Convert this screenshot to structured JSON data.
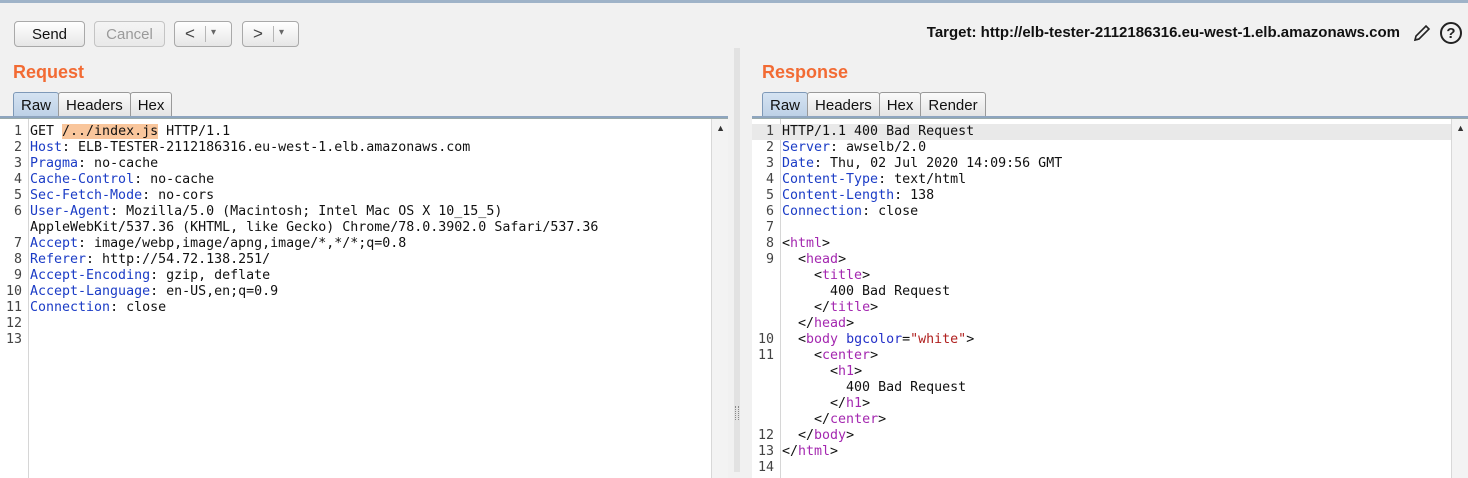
{
  "toolbar": {
    "send_label": "Send",
    "cancel_label": "Cancel",
    "back_label": "<",
    "forward_label": ">",
    "caret": "▾",
    "target_label": "Target: http://elb-tester-2112186316.eu-west-1.elb.amazonaws.com",
    "help_label": "?"
  },
  "request": {
    "title": "Request",
    "tabs": [
      "Raw",
      "Headers",
      "Hex"
    ],
    "active_tab": "Raw",
    "line_numbers": [
      "1",
      "2",
      "3",
      "4",
      "5",
      "6",
      "",
      "7",
      "8",
      "9",
      "10",
      "11",
      "12",
      "13"
    ],
    "lines": [
      [
        {
          "t": "GET "
        },
        {
          "t": "/../index.js",
          "c": "hl"
        },
        {
          "t": " HTTP/1.1"
        }
      ],
      [
        {
          "t": "Host",
          "c": "hdr"
        },
        {
          "t": ": ELB-TESTER-2112186316.eu-west-1.elb.amazonaws.com"
        }
      ],
      [
        {
          "t": "Pragma",
          "c": "hdr"
        },
        {
          "t": ": no-cache"
        }
      ],
      [
        {
          "t": "Cache-Control",
          "c": "hdr"
        },
        {
          "t": ": no-cache"
        }
      ],
      [
        {
          "t": "Sec-Fetch-Mode",
          "c": "hdr"
        },
        {
          "t": ": no-cors"
        }
      ],
      [
        {
          "t": "User-Agent",
          "c": "hdr"
        },
        {
          "t": ": Mozilla/5.0 (Macintosh; Intel Mac OS X 10_15_5)"
        }
      ],
      [
        {
          "t": "AppleWebKit/537.36 (KHTML, like Gecko) Chrome/78.0.3902.0 Safari/537.36"
        }
      ],
      [
        {
          "t": "Accept",
          "c": "hdr"
        },
        {
          "t": ": image/webp,image/apng,image/*,*/*;q=0.8"
        }
      ],
      [
        {
          "t": "Referer",
          "c": "hdr"
        },
        {
          "t": ": http://54.72.138.251/"
        }
      ],
      [
        {
          "t": "Accept-Encoding",
          "c": "hdr"
        },
        {
          "t": ": gzip, deflate"
        }
      ],
      [
        {
          "t": "Accept-Language",
          "c": "hdr"
        },
        {
          "t": ": en-US,en;q=0.9"
        }
      ],
      [
        {
          "t": "Connection",
          "c": "hdr"
        },
        {
          "t": ": close"
        }
      ],
      [],
      []
    ]
  },
  "response": {
    "title": "Response",
    "tabs": [
      "Raw",
      "Headers",
      "Hex",
      "Render"
    ],
    "active_tab": "Raw",
    "line_numbers": [
      "1",
      "2",
      "3",
      "4",
      "5",
      "6",
      "7",
      "8",
      "9",
      "",
      "",
      "",
      "",
      "10",
      "11",
      "",
      "",
      "",
      "",
      "12",
      "13",
      "14"
    ],
    "lines": [
      [
        {
          "t": "HTTP/1.1 400 Bad Request"
        }
      ],
      [
        {
          "t": "Server",
          "c": "hdr"
        },
        {
          "t": ": awselb/2.0"
        }
      ],
      [
        {
          "t": "Date",
          "c": "hdr"
        },
        {
          "t": ": Thu, 02 Jul 2020 14:09:56 GMT"
        }
      ],
      [
        {
          "t": "Content-Type",
          "c": "hdr"
        },
        {
          "t": ": text/html"
        }
      ],
      [
        {
          "t": "Content-Length",
          "c": "hdr"
        },
        {
          "t": ": 138"
        }
      ],
      [
        {
          "t": "Connection",
          "c": "hdr"
        },
        {
          "t": ": close"
        }
      ],
      [],
      [
        {
          "t": "<"
        },
        {
          "t": "html",
          "c": "tag"
        },
        {
          "t": ">"
        }
      ],
      [
        {
          "t": "  <"
        },
        {
          "t": "head",
          "c": "tag"
        },
        {
          "t": ">"
        }
      ],
      [
        {
          "t": "    <"
        },
        {
          "t": "title",
          "c": "tag"
        },
        {
          "t": ">"
        }
      ],
      [
        {
          "t": "      400 Bad Request"
        }
      ],
      [
        {
          "t": "    </"
        },
        {
          "t": "title",
          "c": "tag"
        },
        {
          "t": ">"
        }
      ],
      [
        {
          "t": "  </"
        },
        {
          "t": "head",
          "c": "tag"
        },
        {
          "t": ">"
        }
      ],
      [
        {
          "t": "  <"
        },
        {
          "t": "body",
          "c": "tag"
        },
        {
          "t": " "
        },
        {
          "t": "bgcolor",
          "c": "attr"
        },
        {
          "t": "="
        },
        {
          "t": "\"white\"",
          "c": "val"
        },
        {
          "t": ">"
        }
      ],
      [
        {
          "t": "    <"
        },
        {
          "t": "center",
          "c": "tag"
        },
        {
          "t": ">"
        }
      ],
      [
        {
          "t": "      <"
        },
        {
          "t": "h1",
          "c": "tag"
        },
        {
          "t": ">"
        }
      ],
      [
        {
          "t": "        400 Bad Request"
        }
      ],
      [
        {
          "t": "      </"
        },
        {
          "t": "h1",
          "c": "tag"
        },
        {
          "t": ">"
        }
      ],
      [
        {
          "t": "    </"
        },
        {
          "t": "center",
          "c": "tag"
        },
        {
          "t": ">"
        }
      ],
      [
        {
          "t": "  </"
        },
        {
          "t": "body",
          "c": "tag"
        },
        {
          "t": ">"
        }
      ],
      [
        {
          "t": "</"
        },
        {
          "t": "html",
          "c": "tag"
        },
        {
          "t": ">"
        }
      ],
      []
    ]
  },
  "colors": {
    "accent_title": "#f26b34",
    "header_name": "#1b3cc6",
    "highlight": "#f9c69c",
    "tag": "#a428b0"
  }
}
